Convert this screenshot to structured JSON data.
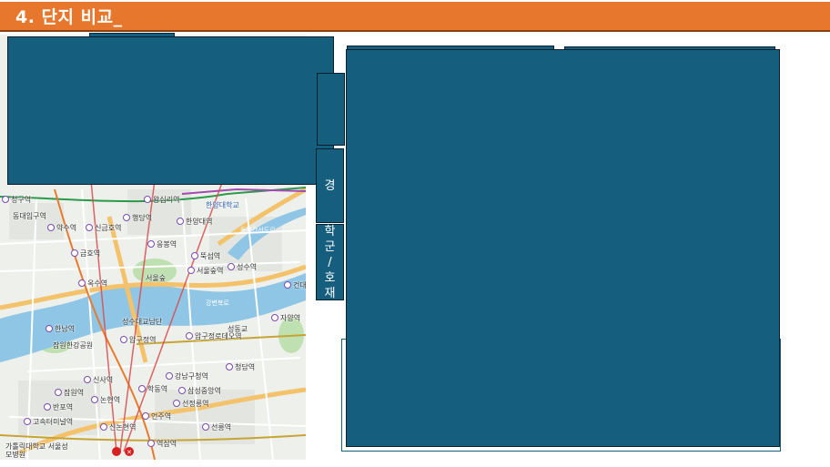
{
  "slide": {
    "title": "4. 단지 비교_"
  },
  "side_tabs": [
    {
      "chars": [
        "경"
      ]
    },
    {
      "chars": [
        "학",
        "군",
        "/",
        "호",
        "재"
      ]
    }
  ],
  "map": {
    "labels": [
      {
        "text": "청구역",
        "style": "station"
      },
      {
        "text": "왕십리역",
        "style": "station"
      },
      {
        "text": "동대입구역",
        "style": "plain"
      },
      {
        "text": "약수역",
        "style": "station"
      },
      {
        "text": "신금호역",
        "style": "station"
      },
      {
        "text": "행당역",
        "style": "station"
      },
      {
        "text": "한양대학교",
        "style": "blue"
      },
      {
        "text": "한양대역",
        "style": "station"
      },
      {
        "text": "금호역",
        "style": "station"
      },
      {
        "text": "응봉역",
        "style": "station"
      },
      {
        "text": "뚝섬역",
        "style": "station"
      },
      {
        "text": "성수역",
        "style": "station"
      },
      {
        "text": "서울숲",
        "style": "plain"
      },
      {
        "text": "서울숲역",
        "style": "station"
      },
      {
        "text": "옥수역",
        "style": "station"
      },
      {
        "text": "건대",
        "style": "station"
      },
      {
        "text": "한남역",
        "style": "station"
      },
      {
        "text": "성수대교남단",
        "style": "plain"
      },
      {
        "text": "압구정역",
        "style": "station"
      },
      {
        "text": "압구정로데오역",
        "style": "station"
      },
      {
        "text": "잠원한강공원",
        "style": "plain"
      },
      {
        "text": "청담역",
        "style": "station"
      },
      {
        "text": "강남구청역",
        "style": "station"
      },
      {
        "text": "신사역",
        "style": "station"
      },
      {
        "text": "잠원역",
        "style": "station"
      },
      {
        "text": "학동역",
        "style": "station"
      },
      {
        "text": "삼성중앙역",
        "style": "station"
      },
      {
        "text": "반포역",
        "style": "station"
      },
      {
        "text": "논현역",
        "style": "station"
      },
      {
        "text": "선정릉역",
        "style": "station"
      },
      {
        "text": "고속터미널역",
        "style": "station"
      },
      {
        "text": "신논현역",
        "style": "station"
      },
      {
        "text": "언주역",
        "style": "station"
      },
      {
        "text": "선릉역",
        "style": "station"
      },
      {
        "text": "가톨릭대학교 서울성모병원",
        "style": "plain"
      },
      {
        "text": "역삼역",
        "style": "station"
      },
      {
        "text": "자양역",
        "style": "station"
      },
      {
        "text": "강변북로",
        "style": "plain"
      },
      {
        "text": "동부간선도로",
        "style": "plain"
      },
      {
        "text": "성동교",
        "style": "plain"
      }
    ]
  },
  "colors": {
    "title_bg": "#e8772e",
    "panel": "#155e7e",
    "panel_border": "#0b1f2c",
    "river": "#8fc6e6",
    "park": "#bfe0b0",
    "road_major": "#f4c26b",
    "route_line": "#d84a4a"
  }
}
